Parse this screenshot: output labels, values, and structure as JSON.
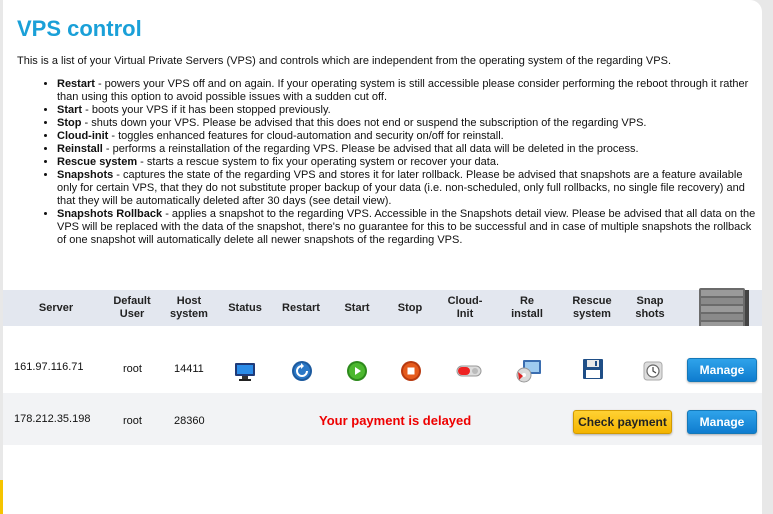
{
  "page": {
    "title": "VPS control",
    "intro": "This is a list of your Virtual Private Servers (VPS) and controls which are independent from the operating system of the regarding VPS."
  },
  "features": [
    {
      "term": "Restart",
      "desc": " - powers your VPS off and on again. If your operating system is still accessible please consider performing the reboot through it rather than using this option to avoid possible issues with a sudden cut off."
    },
    {
      "term": "Start",
      "desc": " - boots your VPS if it has been stopped previously."
    },
    {
      "term": "Stop",
      "desc": " - shuts down your VPS. Please be advised that this does not end or suspend the subscription of the regarding VPS."
    },
    {
      "term": "Cloud-init",
      "desc": " - toggles enhanced features for cloud-automation and security on/off for reinstall."
    },
    {
      "term": "Reinstall",
      "desc": " - performs a reinstallation of the regarding VPS. Please be advised that all data will be deleted in the process."
    },
    {
      "term": "Rescue system",
      "desc": " - starts a rescue system to fix your operating system or recover your data."
    },
    {
      "term": "Snapshots",
      "desc": " - captures the state of the regarding VPS and stores it for later rollback. Please be advised that snapshots are a feature available only for certain VPS, that they do not substitute proper backup of your data (i.e. non-scheduled, only full rollbacks, no single file recovery) and that they will be automatically deleted after 30 days (see detail view)."
    },
    {
      "term": "Snapshots Rollback",
      "desc": " - applies a snapshot to the regarding VPS. Accessible in the Snapshots detail view. Please be advised that all data on the VPS will be replaced with the data of the snapshot, there's no guarantee for this to be successful and in case of multiple snapshots the rollback of one snapshot will automatically delete all newer snapshots of the regarding VPS."
    }
  ],
  "table": {
    "headers": {
      "server": "Server",
      "default_user_1": "Default",
      "default_user_2": "User",
      "host_1": "Host",
      "host_2": "system",
      "status": "Status",
      "restart": "Restart",
      "start": "Start",
      "stop": "Stop",
      "cloudinit_1": "Cloud-",
      "cloudinit_2": "Init",
      "reinstall_1": "Re",
      "reinstall_2": "install",
      "rescue_1": "Rescue",
      "rescue_2": "system",
      "snap_1": "Snap",
      "snap_2": "shots"
    },
    "rows": [
      {
        "server": "161.97.116.71",
        "user": "root",
        "host": "14411",
        "manage": "Manage"
      },
      {
        "server": "178.212.35.198",
        "user": "root",
        "host": "28360",
        "status_message": "Your payment is delayed",
        "check_payment": "Check payment",
        "manage": "Manage"
      }
    ]
  },
  "colors": {
    "title": "#1aa0d8",
    "header_bg": "#e3e7ef",
    "manage": "#1a8ee0",
    "check_payment": "#f4b400",
    "delayed": "#e00000"
  }
}
